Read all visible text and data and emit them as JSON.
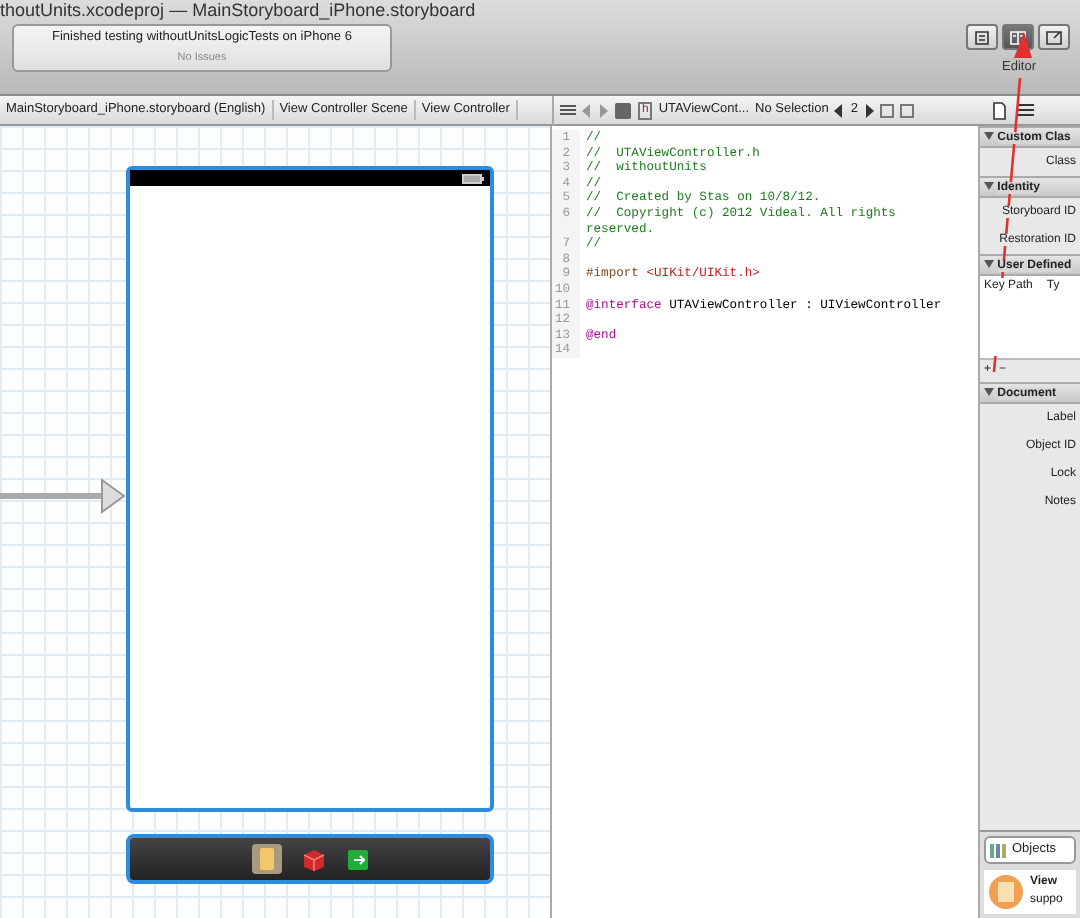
{
  "window": {
    "title_project": "thoutUnits.xcodeproj",
    "title_separator": "—",
    "title_file": "MainStoryboard_iPhone.storyboard"
  },
  "activity": {
    "message": "Finished testing withoutUnitsLogicTests on iPhone 6",
    "issues": "No Issues"
  },
  "editor_buttons": [
    {
      "kind": "standard",
      "selected": false
    },
    {
      "kind": "assistant",
      "selected": true
    },
    {
      "kind": "version",
      "selected": false
    }
  ],
  "editor_label": "Editor",
  "storyboard_jump_bar": [
    "MainStoryboard_iPhone.storyboard (English)",
    "View Controller Scene",
    "View Controller"
  ],
  "code_jump_bar": {
    "file_type": "h",
    "file": "UTAViewCont...",
    "selection": "No Selection",
    "counterpart": "2"
  },
  "code": [
    {
      "number": "1",
      "segments": [
        {
          "kind": "comment",
          "text": "//"
        }
      ]
    },
    {
      "number": "2",
      "segments": [
        {
          "kind": "comment",
          "text": "//  UTAViewController.h"
        }
      ]
    },
    {
      "number": "3",
      "segments": [
        {
          "kind": "comment",
          "text": "//  withoutUnits"
        }
      ]
    },
    {
      "number": "4",
      "segments": [
        {
          "kind": "comment",
          "text": "//"
        }
      ]
    },
    {
      "number": "5",
      "segments": [
        {
          "kind": "comment",
          "text": "//  Created by Stas on 10/8/12."
        }
      ]
    },
    {
      "number": "6",
      "segments": [
        {
          "kind": "comment",
          "text": "//  Copyright (c) 2012 Videal. All rights reserved."
        }
      ]
    },
    {
      "number": "7",
      "segments": [
        {
          "kind": "comment",
          "text": "//"
        }
      ]
    },
    {
      "number": "8"
    },
    {
      "number": "9",
      "segments": [
        {
          "kind": "directive",
          "text": "#import "
        },
        {
          "kind": "string",
          "text": "<UIKit/UIKit.h>"
        }
      ]
    },
    {
      "number": "10"
    },
    {
      "number": "11",
      "segments": [
        {
          "kind": "keyword",
          "text": "@interface"
        },
        {
          "kind": "plain",
          "text": " UTAViewController : UIViewController"
        }
      ]
    },
    {
      "number": "12"
    },
    {
      "number": "13",
      "segments": [
        {
          "kind": "keyword",
          "text": "@end"
        }
      ]
    },
    {
      "number": "14"
    }
  ],
  "inspector": [
    {
      "kind": "header",
      "text": "Custom Clas"
    },
    {
      "kind": "field",
      "text": "Class"
    },
    {
      "kind": "header",
      "text": "Identity"
    },
    {
      "kind": "field",
      "text": "Storyboard ID"
    },
    {
      "kind": "field",
      "text": "Restoration ID"
    },
    {
      "kind": "header",
      "text": "User Defined"
    },
    {
      "kind": "columns",
      "text": "Key Path",
      "text2": "Ty"
    },
    {
      "kind": "addremove",
      "text": "+",
      "text2": "−"
    },
    {
      "kind": "header",
      "text": "Document"
    },
    {
      "kind": "field",
      "text": "Label"
    },
    {
      "kind": "field",
      "text": "Object ID"
    },
    {
      "kind": "field",
      "text": "Lock"
    },
    {
      "kind": "field",
      "text": "Notes"
    }
  ],
  "library": {
    "filter": "Objects",
    "item_title": "View",
    "item_text": "suppo"
  }
}
